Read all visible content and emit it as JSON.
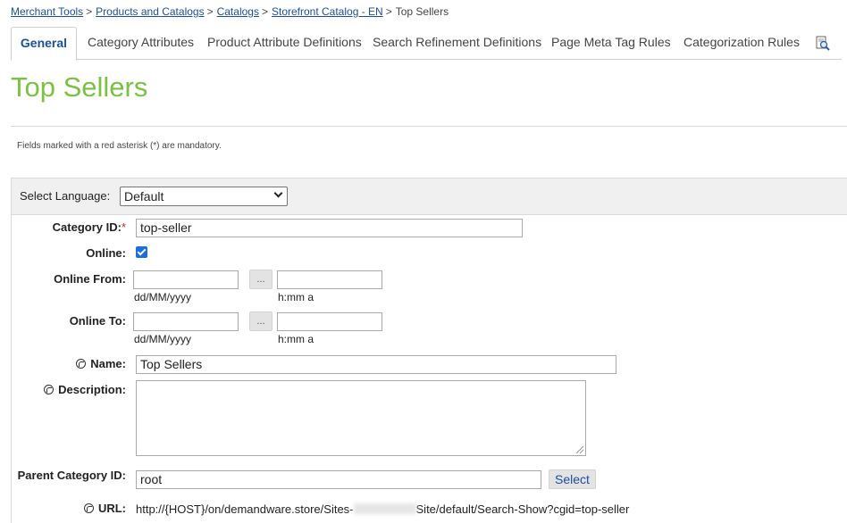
{
  "breadcrumb": {
    "items": [
      "Merchant Tools",
      "Products and Catalogs",
      "Catalogs",
      "Storefront Catalog - EN"
    ],
    "current": "Top Sellers",
    "separator": ">"
  },
  "tabs": [
    {
      "label": "General",
      "active": true
    },
    {
      "label": "Category Attributes"
    },
    {
      "label": "Product Attribute Definitions"
    },
    {
      "label": "Search Refinement Definitions"
    },
    {
      "label": "Page Meta Tag Rules"
    },
    {
      "label": "Categorization Rules"
    }
  ],
  "tab_icon": "search-document-icon",
  "page_title": "Top Sellers",
  "mandatory_note": "Fields marked with a red asterisk (*) are mandatory.",
  "language": {
    "label": "Select Language:",
    "selected": "Default"
  },
  "form": {
    "category_id": {
      "label": "Category ID:",
      "required_mark": "*",
      "value": "top-seller"
    },
    "online": {
      "label": "Online:",
      "checked": true
    },
    "online_from": {
      "label": "Online From:",
      "date_hint": "dd/MM/yyyy",
      "time_hint": "h:mm a",
      "button": "..."
    },
    "online_to": {
      "label": "Online To:",
      "date_hint": "dd/MM/yyyy",
      "time_hint": "h:mm a",
      "button": "..."
    },
    "name": {
      "label": "Name:",
      "value": "Top Sellers",
      "icon": "globe-icon"
    },
    "description": {
      "label": "Description:",
      "value": "",
      "icon": "globe-icon"
    },
    "parent_category": {
      "label": "Parent Category ID:",
      "value": "root",
      "button": "Select"
    },
    "url": {
      "label": "URL:",
      "prefix": "http://{HOST}/on/demandware.store/Sites-",
      "suffix": "Site/default/Search-Show?cgid=top-seller",
      "icon": "globe-icon"
    }
  },
  "colors": {
    "title": "#7cc242",
    "link": "#1a4f9c",
    "required": "#e02020"
  }
}
